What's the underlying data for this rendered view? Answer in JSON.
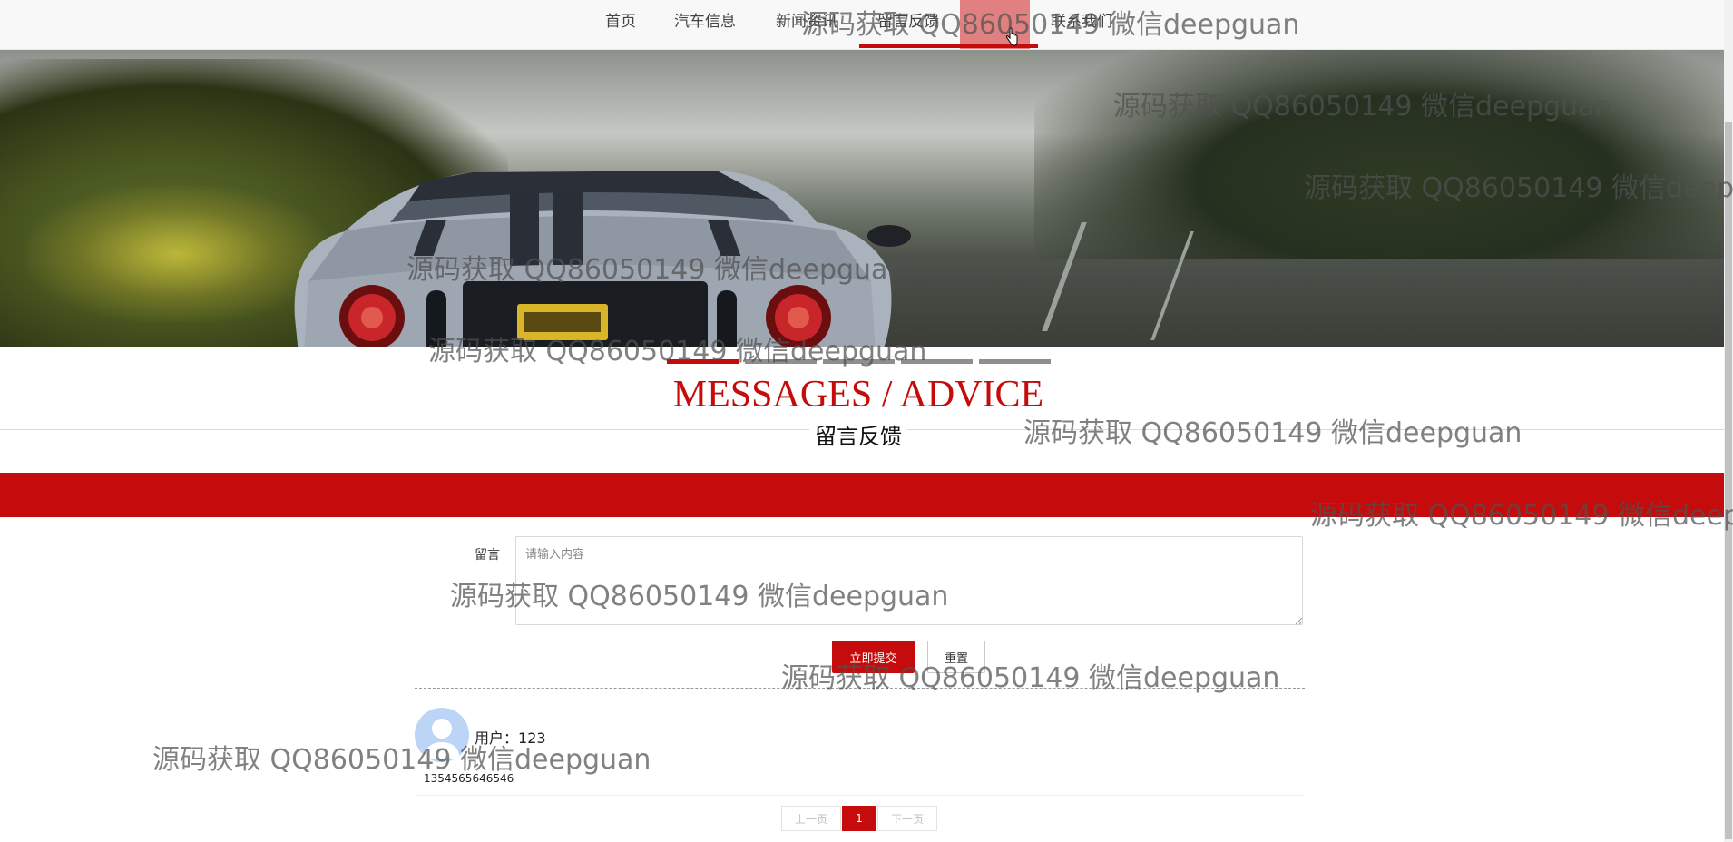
{
  "nav": {
    "items": [
      "首页",
      "汽车信息",
      "新闻资讯",
      "留言反馈",
      "联系我们"
    ]
  },
  "banner": {
    "slide_count": 5,
    "active_index": 0
  },
  "section": {
    "title_en": "MESSAGES / ADVICE",
    "title_cn": "留言反馈"
  },
  "form": {
    "label": "留言",
    "placeholder": "请输入内容",
    "value": "",
    "submit_label": "立即提交",
    "reset_label": "重置"
  },
  "comments": [
    {
      "user_label": "用户：",
      "user": "123",
      "content": "1354565646546"
    }
  ],
  "pagination": {
    "prev": "上一页",
    "current": "1",
    "next": "下一页"
  },
  "watermark": "源码获取 QQ86050149 微信deepguan",
  "colors": {
    "accent": "#c50b0b",
    "nav_bg": "#f8f8f8"
  }
}
